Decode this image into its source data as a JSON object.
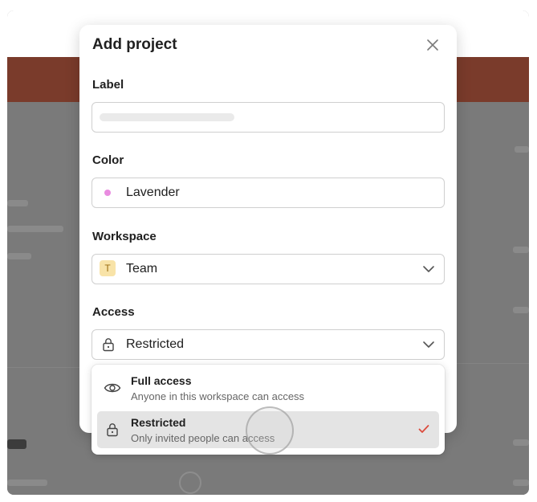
{
  "modal": {
    "title": "Add project",
    "close_icon": "close-icon"
  },
  "fields": {
    "label": {
      "title": "Label",
      "value": ""
    },
    "color": {
      "title": "Color",
      "value": "Lavender",
      "dot_color": "#e98ce0"
    },
    "workspace": {
      "title": "Workspace",
      "value": "Team",
      "avatar_letter": "T"
    },
    "access": {
      "title": "Access",
      "value": "Restricted",
      "icon": "lock-icon"
    }
  },
  "access_menu": {
    "options": [
      {
        "title": "Full access",
        "description": "Anyone in this workspace can access",
        "icon": "eye-icon",
        "selected": false
      },
      {
        "title": "Restricted",
        "description": "Only invited people can access",
        "icon": "lock-icon",
        "selected": true
      }
    ]
  },
  "colors": {
    "check_accent": "#dc4c3e",
    "backdrop_band": "#7a3b2b"
  }
}
